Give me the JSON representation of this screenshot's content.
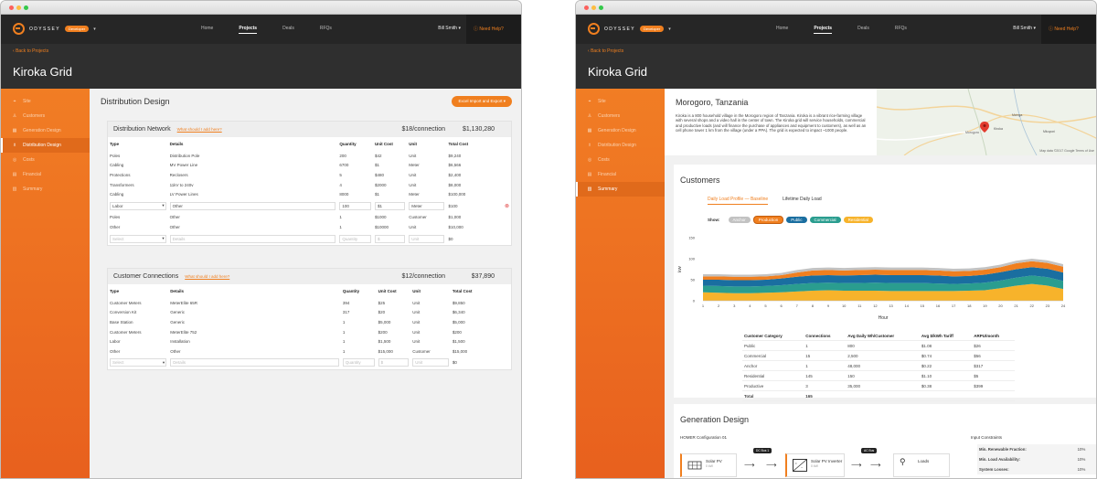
{
  "app": {
    "logo_text": "ODYSSEY",
    "badge": "Developer",
    "nav": [
      "Home",
      "Projects",
      "Deals",
      "RFQs"
    ],
    "active_nav": "Projects",
    "user": "Bill Smith ▾",
    "help": "Need Help?",
    "back": "Back to Projects",
    "project_title": "Kiroka Grid"
  },
  "sidebar": {
    "left_items": [
      {
        "label": "Site",
        "icon": "pin-icon"
      },
      {
        "label": "Customers",
        "icon": "person-icon"
      },
      {
        "label": "Generation Design",
        "icon": "solar-icon"
      },
      {
        "label": "Distribution Design",
        "icon": "tower-icon"
      },
      {
        "label": "Costs",
        "icon": "coin-icon"
      },
      {
        "label": "Financial",
        "icon": "chart-icon"
      },
      {
        "label": "Summary",
        "icon": "doc-icon"
      }
    ],
    "left_active": "Distribution Design",
    "right_active": "Summary"
  },
  "distribution": {
    "title": "Distribution Design",
    "excel_button": "Excel Import and Export ▾",
    "help_link": "What should I add here?",
    "network": {
      "title": "Distribution Network",
      "rate": "$18/connection",
      "total": "$1,130,280",
      "columns": [
        "Type",
        "Details",
        "Quantity",
        "Unit Cost",
        "Unit",
        "Total Cost"
      ],
      "rows": [
        [
          "Poles",
          "Distribution Pole",
          "200",
          "$42",
          "Unit",
          "$9,240"
        ],
        [
          "Cabling",
          "MV Power Line",
          "6700",
          "$1",
          "Meter",
          "$6,566"
        ],
        [
          "Protections",
          "Reclosers",
          "5",
          "$480",
          "Unit",
          "$2,400"
        ],
        [
          "Transformers",
          "11kV to 240v",
          "4",
          "$2000",
          "Unit",
          "$8,000"
        ],
        [
          "Cabling",
          "LV Power Lines",
          "8000",
          "$1",
          "Meter",
          "$100,000"
        ],
        [
          "Labor",
          "Other",
          "100",
          "$1",
          "Meter",
          "$100"
        ],
        [
          "Poles",
          "Other",
          "1",
          "$1000",
          "Customer",
          "$1,000"
        ],
        [
          "Other",
          "Other",
          "1",
          "$10000",
          "Unit",
          "$10,000"
        ]
      ],
      "new_row": {
        "type": "Select",
        "details": "Details",
        "quantity": "Quantity",
        "unit_cost": "$",
        "unit": "Unit",
        "total": "$0"
      }
    },
    "connections": {
      "title": "Customer Connections",
      "rate": "$12/connection",
      "total": "$37,890",
      "columns": [
        "Type",
        "Details",
        "Quantity",
        "Unit Cost",
        "Unit",
        "Total Cost"
      ],
      "rows": [
        [
          "Customer Meters",
          "MeterElite 65R",
          "394",
          "$25",
          "Unit",
          "$9,850"
        ],
        [
          "Conversion Kit",
          "Generic",
          "317",
          "$20",
          "Unit",
          "$6,340"
        ],
        [
          "Base Station",
          "Generic",
          "1",
          "$5,000",
          "Unit",
          "$5,000"
        ],
        [
          "Customer Meters",
          "MeterElite 752",
          "1",
          "$200",
          "Unit",
          "$200"
        ],
        [
          "Labor",
          "Installation",
          "1",
          "$1,500",
          "Unit",
          "$1,500"
        ],
        [
          "Other",
          "Other",
          "1",
          "$15,000",
          "Customer",
          "$15,000"
        ]
      ],
      "new_row": {
        "type": "Select",
        "details": "Details",
        "quantity": "Quantity",
        "unit_cost": "$",
        "unit": "Unit",
        "total": "$0"
      }
    }
  },
  "summary": {
    "location": "Morogoro, Tanzania",
    "description": "Kiroka is a 800 household village in the Morogoro region of Tanzania. Kiroka is a vibrant rice-farming village with several shops and a video hall in the center of town. The Kiroka grid will service households, commercial and productive loads (and will finance the purchase of appliances and equipment to customers), as well as an cell phone tower 1 km from the village (under a PPA). The grid is expected to impact ~1000 people.",
    "map": {
      "attribution": "Map data ©2017 Google   Terms of Use",
      "labels": [
        "Mzinga",
        "Morogoro",
        "Kiroka",
        "Mkuyuni"
      ]
    },
    "customers": {
      "title": "Customers",
      "tabs": [
        "Daily Load Profile — Baseline",
        "Lifetime Daily Load"
      ],
      "show_label": "Show:",
      "pills": [
        {
          "label": "Anchor",
          "color": "#c2c2c2"
        },
        {
          "label": "Production",
          "color": "#f07f1f"
        },
        {
          "label": "Public",
          "color": "#1a6ea0"
        },
        {
          "label": "Commercial",
          "color": "#2a9d8f"
        },
        {
          "label": "Residential",
          "color": "#f7b32b"
        }
      ],
      "table_columns": [
        "Customer Category",
        "Connections",
        "Avg Daily Wh/Customer",
        "Avg $/kWh Tariff",
        "ARPU/month"
      ],
      "table_rows": [
        [
          "Public",
          "1",
          "800",
          "$1.08",
          "$26"
        ],
        [
          "Commercial",
          "15",
          "2,500",
          "$0.74",
          "$56"
        ],
        [
          "Anchor",
          "1",
          "48,000",
          "$0.22",
          "$317"
        ],
        [
          "Residential",
          "145",
          "150",
          "$1.10",
          "$5"
        ],
        [
          "Productive",
          "3",
          "35,000",
          "$0.38",
          "$399"
        ]
      ],
      "total_label": "Total",
      "total_connections": "165"
    },
    "generation": {
      "title": "Generation Design",
      "config": "HOMER Configuration 01",
      "components": [
        {
          "label": "Solar PV",
          "sub": "0 kW"
        },
        {
          "label": "Solar PV Inverter",
          "sub": "0 kW"
        },
        {
          "label": "Loads",
          "sub": ""
        }
      ],
      "buses": [
        "DC Bus 1",
        "AC Bus"
      ],
      "constraints_title": "Input Constraints",
      "constraints": [
        [
          "Min. Renewable Fraction:",
          "10%"
        ],
        [
          "Min. Load Availability:",
          "10%"
        ],
        [
          "System Losses:",
          "10%"
        ]
      ]
    }
  },
  "chart_data": {
    "type": "area",
    "title": "",
    "xlabel": "Hour",
    "ylabel": "kW",
    "ylim": [
      0,
      150
    ],
    "yticks": [
      0,
      50,
      100,
      150
    ],
    "x": [
      1,
      2,
      3,
      4,
      5,
      6,
      7,
      8,
      9,
      10,
      11,
      12,
      13,
      14,
      15,
      16,
      17,
      18,
      19,
      20,
      21,
      22,
      23,
      24
    ],
    "series": [
      {
        "name": "Residential",
        "color": "#f7b32b",
        "values": [
          20,
          19,
          18,
          18,
          19,
          20,
          22,
          24,
          25,
          24,
          24,
          24,
          23,
          23,
          23,
          23,
          23,
          24,
          25,
          30,
          36,
          40,
          36,
          28
        ]
      },
      {
        "name": "Commercial",
        "color": "#2a9d8f",
        "values": [
          16,
          16,
          16,
          16,
          16,
          17,
          18,
          18,
          18,
          18,
          18,
          19,
          19,
          19,
          19,
          18,
          17,
          17,
          18,
          18,
          19,
          20,
          20,
          19
        ]
      },
      {
        "name": "Public",
        "color": "#1a6ea0",
        "values": [
          14,
          15,
          15,
          15,
          15,
          16,
          17,
          18,
          18,
          18,
          19,
          19,
          19,
          19,
          19,
          19,
          18,
          18,
          19,
          20,
          20,
          20,
          20,
          20
        ]
      },
      {
        "name": "Production",
        "color": "#f07f1f",
        "values": [
          8,
          8,
          8,
          8,
          8,
          8,
          10,
          12,
          12,
          12,
          12,
          12,
          12,
          12,
          12,
          12,
          12,
          12,
          12,
          12,
          14,
          14,
          14,
          14
        ]
      },
      {
        "name": "Anchor",
        "color": "#c2c2c2",
        "values": [
          5,
          5,
          5,
          5,
          5,
          5,
          6,
          6,
          6,
          6,
          6,
          6,
          6,
          6,
          6,
          6,
          6,
          6,
          6,
          6,
          6,
          6,
          6,
          6
        ]
      }
    ]
  }
}
